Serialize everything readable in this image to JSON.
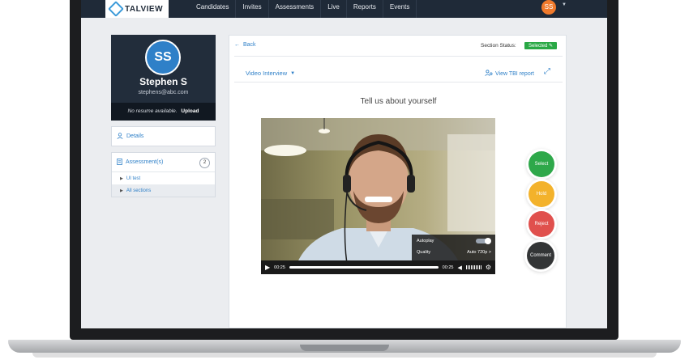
{
  "brand": {
    "name": "TALVIEW"
  },
  "nav": {
    "items": [
      "Candidates",
      "Invites",
      "Assessments",
      "Live",
      "Reports",
      "Events"
    ]
  },
  "user": {
    "initials": "SS"
  },
  "candidate": {
    "initials": "SS",
    "name": "Stephen S",
    "email": "stephens@abc.com",
    "resume_note": "No resume available.",
    "upload_label": "Upload"
  },
  "sidebar": {
    "details_label": "Details",
    "assessments_label": "Assessment(s)",
    "assessments_count": "2",
    "items": [
      {
        "label": "UI test"
      },
      {
        "label": "All sections"
      }
    ]
  },
  "panel": {
    "back_label": "Back",
    "section_status_label": "Section Status:",
    "section_status_value": "Selected",
    "tab_label": "Video Interview",
    "tbi_label": "View TBI report",
    "question": "Tell us about yourself"
  },
  "player": {
    "autoplay_label": "Autoplay",
    "quality_label": "Quality",
    "quality_value": "Auto 720p >",
    "time_current": "00:25",
    "time_total": "00:25",
    "autoplay_on": true
  },
  "actions": [
    {
      "label": "Select",
      "color": "#2ea84a"
    },
    {
      "label": "Hold",
      "color": "#f3b22b"
    },
    {
      "label": "Reject",
      "color": "#e0504d"
    },
    {
      "label": "Comment",
      "color": "#333536"
    }
  ],
  "colors": {
    "accent": "#2f80c8",
    "topbar": "#1f2a38",
    "status_green": "#29a845"
  }
}
